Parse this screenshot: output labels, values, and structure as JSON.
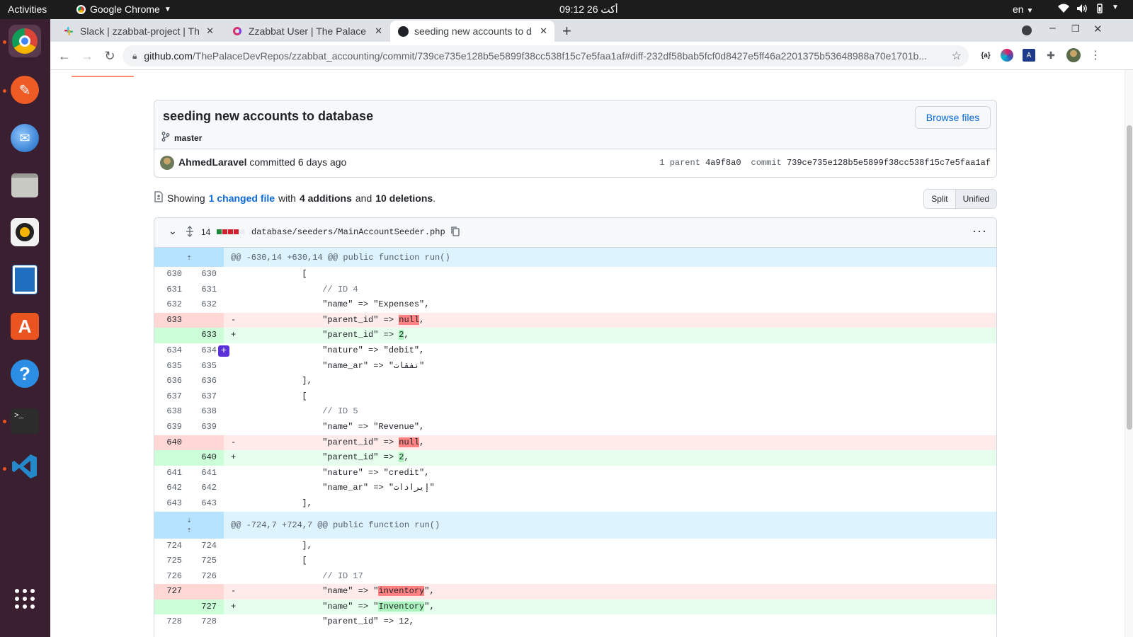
{
  "system": {
    "activities": "Activities",
    "app_name": "Google Chrome",
    "clock": "09:12  26 أكت",
    "lang": "en"
  },
  "browser": {
    "tabs": [
      {
        "title": "Slack | zzabbat-project | Th",
        "icon": "slack-icon"
      },
      {
        "title": "Zzabbat User | The Palace",
        "icon": "app-icon"
      },
      {
        "title": "seeding new accounts to d",
        "icon": "github-icon"
      }
    ],
    "url_domain": "github.com",
    "url_path": "/ThePalaceDevRepos/zzabbat_accounting/commit/739ce735e128b5e5899f38cc538f15c7e5faa1af#diff-232df58bab5fcf0d8427e5ff46a2201375b53648988a70e1701b..."
  },
  "commit": {
    "title": "seeding new accounts to database",
    "branch": "master",
    "browse_label": "Browse files",
    "author": "AhmedLaravel",
    "committed_text": "committed 6 days ago",
    "parent_label": "1 parent",
    "parent_sha": "4a9f8a0",
    "commit_label": "commit",
    "commit_sha": "739ce735e128b5e5899f38cc538f15c7e5faa1af"
  },
  "summary": {
    "showing": "Showing",
    "changed": "1 changed file",
    "with": "with",
    "additions": "4 additions",
    "and": "and",
    "deletions": "10 deletions",
    "end": ".",
    "split": "Split",
    "unified": "Unified"
  },
  "file": {
    "changes": "14",
    "path": "database/seeders/MainAccountSeeder.php",
    "hunk1": "@@ -630,14 +630,14 @@ public function run()",
    "hunk2": "@@ -724,7 +724,7 @@ public function run()"
  },
  "lines1": [
    {
      "t": "ctx",
      "o": "630",
      "n": "630",
      "code": "            ["
    },
    {
      "t": "ctx",
      "o": "631",
      "n": "631",
      "code": "                // ID 4",
      "cls": "c"
    },
    {
      "t": "ctx",
      "o": "632",
      "n": "632",
      "code": "                \"name\" => \"Expenses\","
    },
    {
      "t": "del",
      "o": "633",
      "n": "",
      "code": "                \"parent_id\" => ",
      "hl": "null",
      "tail": ","
    },
    {
      "t": "add",
      "o": "",
      "n": "633",
      "code": "                \"parent_id\" => ",
      "hl": "2",
      "tail": ","
    },
    {
      "t": "ctx",
      "o": "634",
      "n": "634",
      "code": "                \"nature\" => \"debit\","
    },
    {
      "t": "ctx",
      "o": "635",
      "n": "635",
      "code": "                \"name_ar\" => \"نفقات\""
    },
    {
      "t": "ctx",
      "o": "636",
      "n": "636",
      "code": "            ],"
    },
    {
      "t": "ctx",
      "o": "637",
      "n": "637",
      "code": "            ["
    },
    {
      "t": "ctx",
      "o": "638",
      "n": "638",
      "code": "                // ID 5",
      "cls": "c"
    },
    {
      "t": "ctx",
      "o": "639",
      "n": "639",
      "code": "                \"name\" => \"Revenue\","
    },
    {
      "t": "del",
      "o": "640",
      "n": "",
      "code": "                \"parent_id\" => ",
      "hl": "null",
      "tail": ","
    },
    {
      "t": "add",
      "o": "",
      "n": "640",
      "code": "                \"parent_id\" => ",
      "hl": "2",
      "tail": ","
    },
    {
      "t": "ctx",
      "o": "641",
      "n": "641",
      "code": "                \"nature\" => \"credit\","
    },
    {
      "t": "ctx",
      "o": "642",
      "n": "642",
      "code": "                \"name_ar\" => \"إيرادات\""
    },
    {
      "t": "ctx",
      "o": "643",
      "n": "643",
      "code": "            ],"
    }
  ],
  "lines2": [
    {
      "t": "ctx",
      "o": "724",
      "n": "724",
      "code": "            ],"
    },
    {
      "t": "ctx",
      "o": "725",
      "n": "725",
      "code": "            ["
    },
    {
      "t": "ctx",
      "o": "726",
      "n": "726",
      "code": "                // ID 17",
      "cls": "c"
    },
    {
      "t": "del",
      "o": "727",
      "n": "",
      "code": "                \"name\" => \"",
      "hl": "inventory",
      "tail": "\","
    },
    {
      "t": "add",
      "o": "",
      "n": "727",
      "code": "                \"name\" => \"",
      "hl": "Inventory",
      "tail": "\","
    },
    {
      "t": "ctx",
      "o": "728",
      "n": "728",
      "code": "                \"parent_id\" => 12,"
    }
  ]
}
